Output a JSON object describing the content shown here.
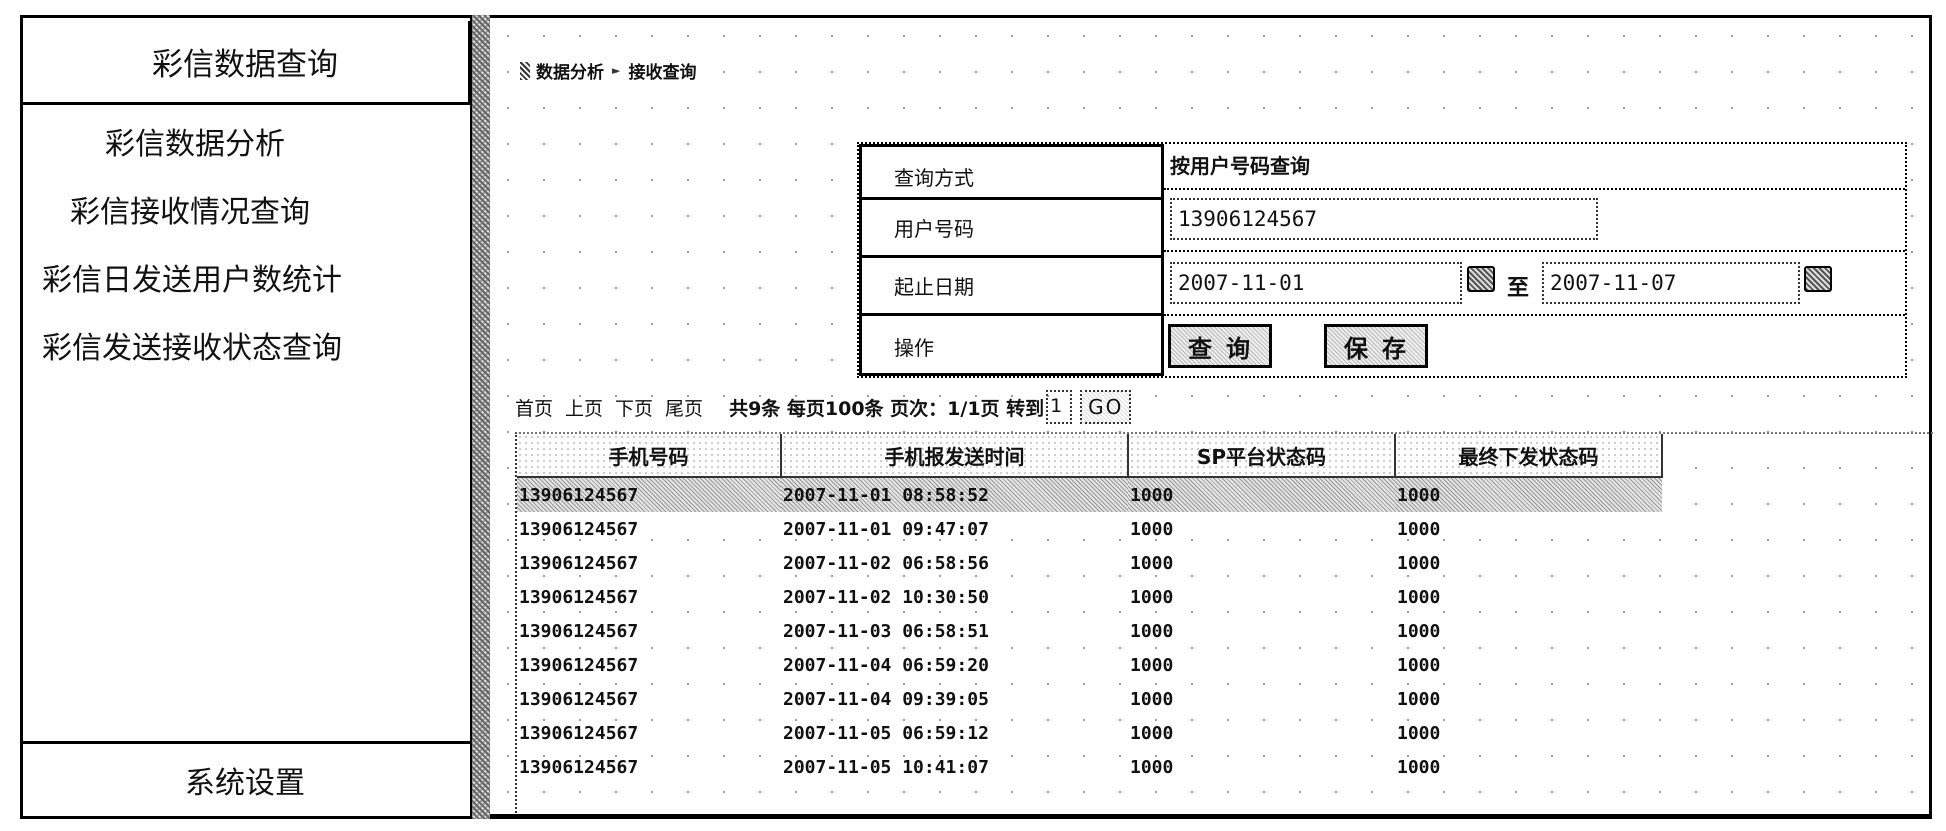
{
  "sidebar": {
    "header": "彩信数据查询",
    "items": [
      {
        "label": "彩信数据分析"
      },
      {
        "label": "彩信接收情况查询"
      },
      {
        "label": "彩信日发送用户数统计"
      },
      {
        "label": "彩信发送接收状态查询"
      }
    ],
    "footer": "系统设置"
  },
  "breadcrumb": {
    "items": [
      "数据分析",
      "接收查询"
    ],
    "icons": [
      "page-icon",
      "arrow-right-icon"
    ]
  },
  "query_form": {
    "labels": {
      "mode": "查询方式",
      "user_number": "用户号码",
      "date_range": "起止日期",
      "actions": "操作"
    },
    "mode_value": "按用户号码查询",
    "user_number_value": "13906124567",
    "start_date": "2007-11-01",
    "end_date": "2007-11-07",
    "to_label": "至",
    "query_button": "查询",
    "save_button": "保存"
  },
  "pager": {
    "first": "首页",
    "prev": "上页",
    "next": "下页",
    "last": "尾页",
    "info": "共9条 每页100条 页次：1/1页 转到",
    "goto_value": "1",
    "go_button": "GO"
  },
  "grid": {
    "columns": [
      "手机号码",
      "手机报发送时间",
      "SP平台状态码",
      "最终下发状态码"
    ],
    "selected_row": 0,
    "rows": [
      [
        "13906124567",
        "2007-11-01 08:58:52",
        "1000",
        "1000"
      ],
      [
        "13906124567",
        "2007-11-01 09:47:07",
        "1000",
        "1000"
      ],
      [
        "13906124567",
        "2007-11-02 06:58:56",
        "1000",
        "1000"
      ],
      [
        "13906124567",
        "2007-11-02 10:30:50",
        "1000",
        "1000"
      ],
      [
        "13906124567",
        "2007-11-03 06:58:51",
        "1000",
        "1000"
      ],
      [
        "13906124567",
        "2007-11-04 06:59:20",
        "1000",
        "1000"
      ],
      [
        "13906124567",
        "2007-11-04 09:39:05",
        "1000",
        "1000"
      ],
      [
        "13906124567",
        "2007-11-05 06:59:12",
        "1000",
        "1000"
      ],
      [
        "13906124567",
        "2007-11-05 10:41:07",
        "1000",
        "1000"
      ]
    ]
  }
}
